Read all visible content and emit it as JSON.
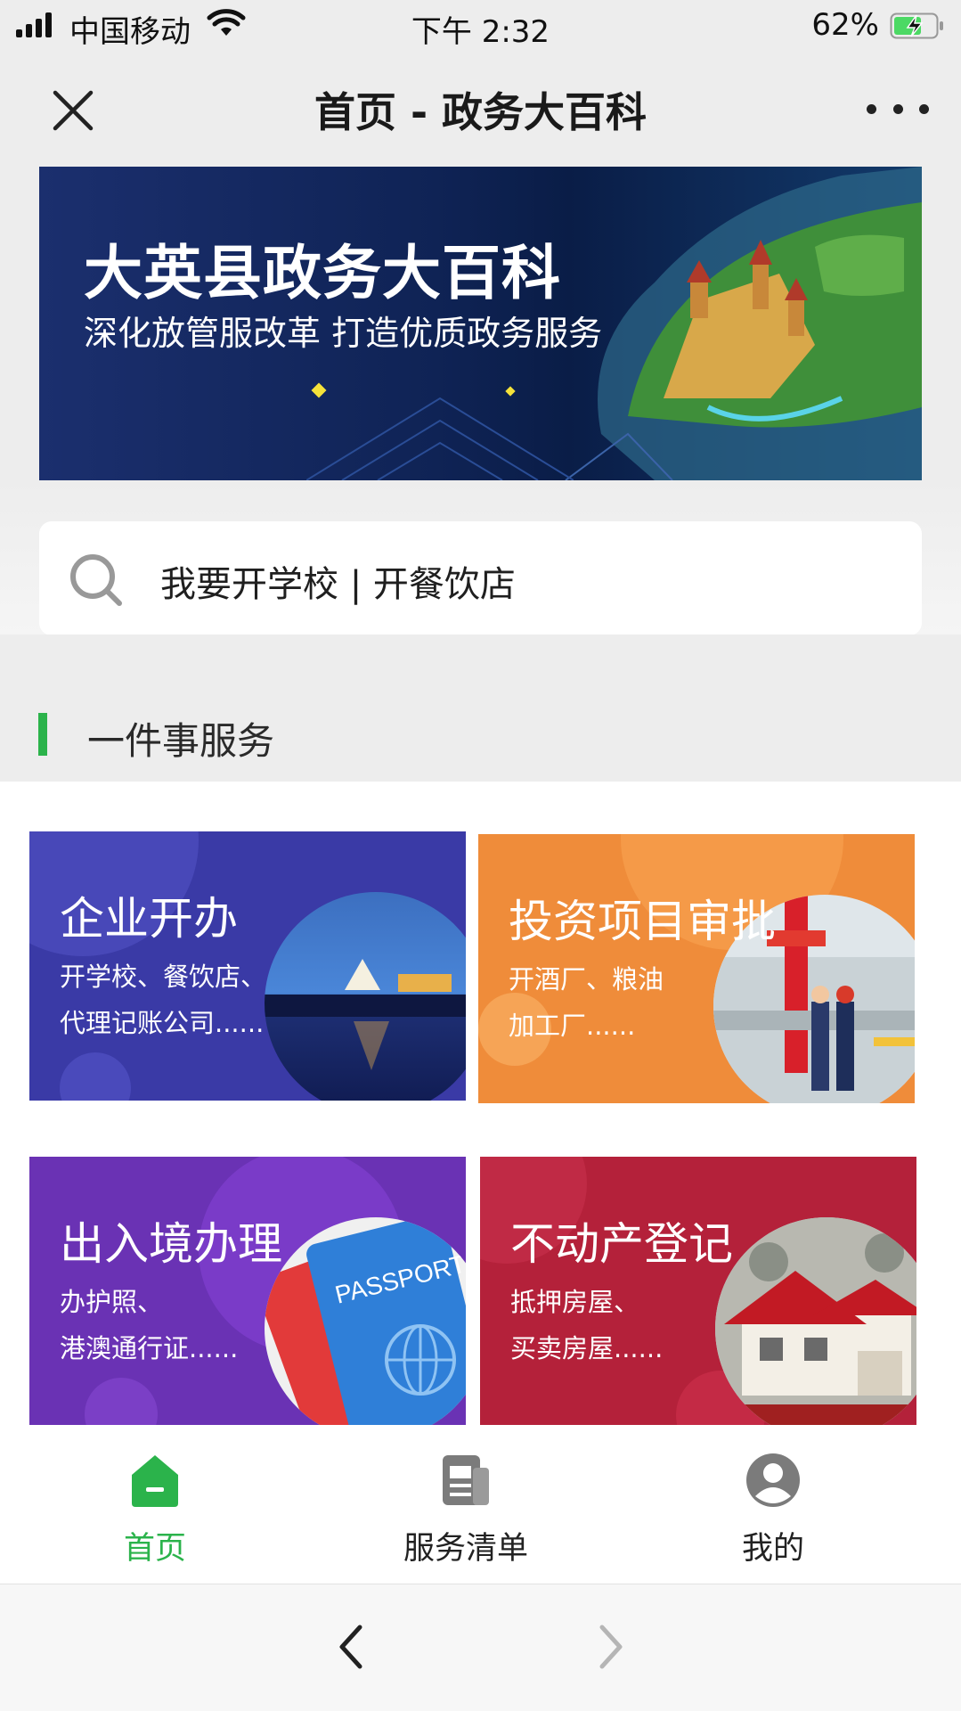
{
  "status_bar": {
    "carrier": "中国移动",
    "time": "下午 2:32",
    "battery": "62%"
  },
  "header": {
    "title": "首页 - 政务大百科"
  },
  "banner": {
    "title": "大英县政务大百科",
    "subtitle": "深化放管服改革 打造优质政务服务"
  },
  "search": {
    "placeholder": "我要开学校 | 开餐饮店"
  },
  "section": {
    "title": "一件事服务",
    "accent_color": "#2bb34b"
  },
  "cards": [
    {
      "title": "企业开办",
      "desc_line1": "开学校、餐饮店、",
      "desc_line2": "代理记账公司......",
      "color": "#3a3aa6"
    },
    {
      "title": "投资项目审批",
      "desc_line1": "开酒厂、粮油",
      "desc_line2": "加工厂......",
      "color": "#ef8c3a"
    },
    {
      "title": "出入境办理",
      "desc_line1": "办护照、",
      "desc_line2": "港澳通行证......",
      "color": "#6a32b4",
      "photo_text": "PASSPORT"
    },
    {
      "title": "不动产登记",
      "desc_line1": "抵押房屋、",
      "desc_line2": "买卖房屋......",
      "color": "#b4213a"
    }
  ],
  "tabbar": {
    "items": [
      {
        "label": "首页",
        "icon": "home-icon",
        "active": true
      },
      {
        "label": "服务清单",
        "icon": "document-list-icon",
        "active": false
      },
      {
        "label": "我的",
        "icon": "user-icon",
        "active": false
      }
    ],
    "active_color": "#2bb34b"
  }
}
